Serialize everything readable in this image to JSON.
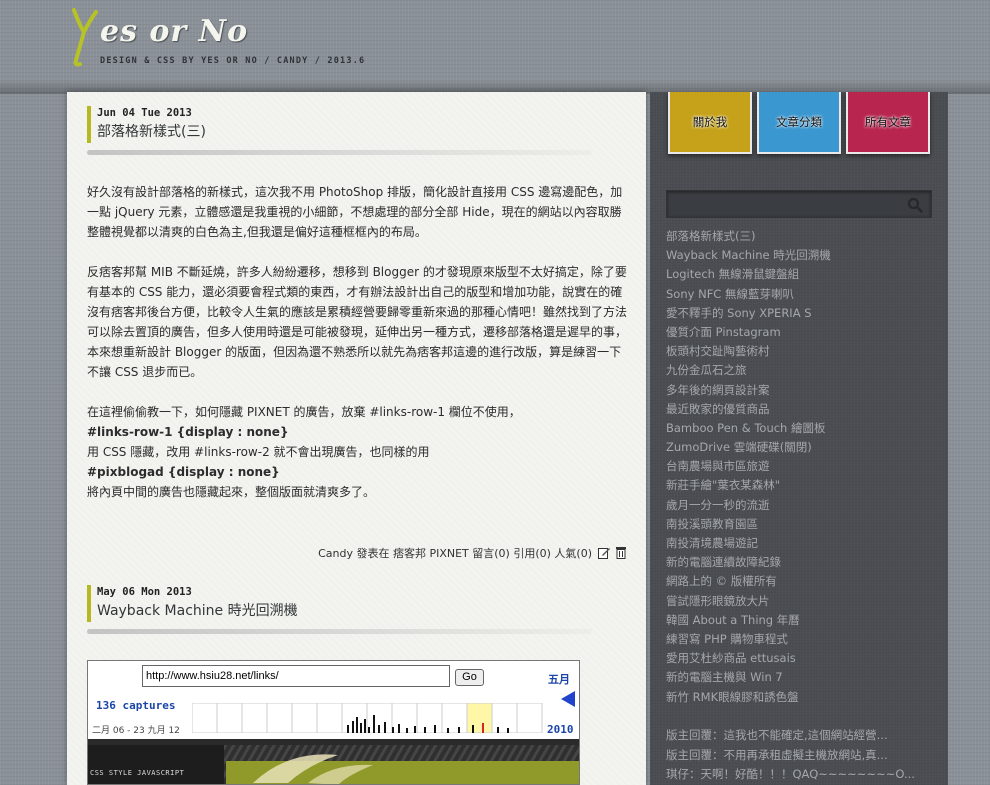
{
  "header": {
    "logo_text": "es or No",
    "subtitle": "DESIGN & CSS BY YES OR NO / CANDY / 2013.6"
  },
  "colors": {
    "accent_green": "#b6b823",
    "nav_about": "#c6a21b",
    "nav_categories": "#3a97d0",
    "nav_all": "#b8254f"
  },
  "posts": [
    {
      "date": "Jun 04 Tue 2013",
      "title": "部落格新樣式(三)",
      "paragraphs": [
        "好久沒有設計部落格的新樣式，這次我不用 PhotoShop 排版，簡化設計直接用 CSS 邊寫邊配色，加一點 jQuery 元素，立體感還是我重視的小細節，不想處理的部分全部 Hide，現在的網站以內容取勝整體視覺都以清爽的白色為主,但我還是偏好這種框框內的布局。",
        "反痞客邦幫 MIB 不斷延燒，許多人紛紛遷移，想移到 Blogger 的才發現原來版型不太好搞定，除了要有基本的 CSS 能力，還必須要會程式類的東西，才有辦法設計出自己的版型和增加功能，說實在的確沒有痞客邦後台方便，比較令人生氣的應該是累積經營要歸零重新來過的那種心情吧！雖然找到了方法可以除去置頂的廣告，但多人使用時還是可能被發現，延伸出另一種方式，遷移部落格還是遲早的事，本來想重新設計 Blogger 的版面，但因為還不熟悉所以就先為痞客邦這邊的進行改版，算是練習一下不讓 CSS 退步而已。"
      ],
      "tip_lines": [
        "在這裡偷偷教一下，如何隱藏 PIXNET 的廣告，放棄 #links-row-1 欄位不使用，",
        "#links-row-1 {display : none}",
        "用 CSS 隱藏，改用 #links-row-2 就不會出現廣告，也同樣的用",
        "#pixblogad {display : none}",
        "將內頁中間的廣告也隱藏起來，整個版面就清爽多了。"
      ],
      "meta": "Candy 發表在 痞客邦 PIXNET 留言(0) 引用(0) 人氣(0)"
    },
    {
      "date": "May 06 Mon 2013",
      "title": "Wayback Machine 時光回溯機"
    }
  ],
  "wayback": {
    "url": "http://www.hsiu28.net/links/",
    "go_label": "Go",
    "month": "五月",
    "captures": "136 captures",
    "range": "二月 06 - 23 九月 12",
    "year": "2010",
    "site_label": "CSS STYLE JAVASCRIPT"
  },
  "nav": {
    "about": "關於我",
    "categories": "文章分類",
    "all": "所有文章"
  },
  "search": {
    "placeholder": ""
  },
  "recent_posts": [
    "部落格新樣式(三)",
    "Wayback Machine 時光回溯機",
    "Logitech 無線滑鼠鍵盤組",
    "Sony NFC 無線藍芽喇叭",
    "愛不釋手的 Sony XPERIA S",
    "優質介面 Pinstagram",
    "板頭村交趾陶藝術村",
    "九份金瓜石之旅",
    "多年後的網頁設計案",
    "最近敗家的優質商品",
    "Bamboo Pen & Touch 繪圖板",
    "ZumoDrive 雲端硬碟(關閉)",
    "台南農場與市區旅遊",
    "新莊手繪\"葉衣某森林\"",
    "歲月一分一秒的流逝",
    "南投溪頭教育園區",
    "南投清境農場遊記",
    "新的電腦連續故障紀錄",
    "網路上的 © 版權所有",
    "嘗試隱形眼鏡放大片",
    "韓國 About a Thing 年曆",
    "練習寫 PHP 購物車程式",
    "愛用艾杜紗商品 ettusais",
    "新的電腦主機與 Win 7",
    "新竹 RMK眼線膠和誘色盤"
  ],
  "recent_comments": [
    "版主回覆：這我也不能確定,這個網站經營...",
    "版主回覆：不用再承租虛擬主機放網站,真...",
    "琪仔：天啊！好酷！！！QAQ~~~~~~~~O..."
  ]
}
